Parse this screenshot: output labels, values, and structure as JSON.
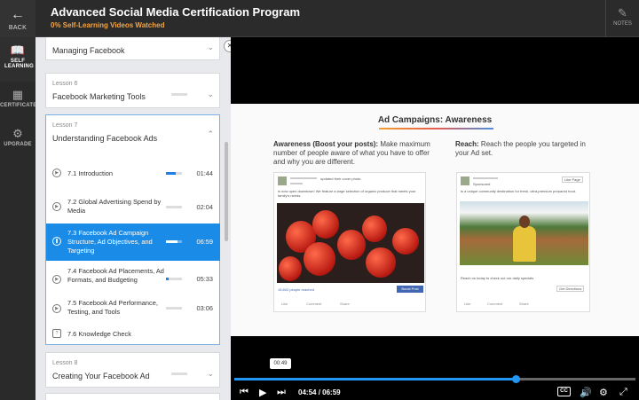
{
  "header": {
    "back_label": "BACK",
    "title": "Advanced Social Media Certification Program",
    "subtitle": "0% Self-Learning Videos Watched",
    "notes_label": "NOTES"
  },
  "leftnav": {
    "items": [
      {
        "label": "SELF LEARNING",
        "icon": "book-icon"
      },
      {
        "label": "CERTIFICATE",
        "icon": "certificate-icon"
      },
      {
        "label": "UPGRADE",
        "icon": "upgrade-icon"
      }
    ]
  },
  "lessons": {
    "prev_card_title": "Managing Facebook",
    "lesson6": {
      "number": "Lesson 6",
      "title": "Facebook Marketing Tools"
    },
    "lesson7": {
      "number": "Lesson 7",
      "title": "Understanding Facebook Ads",
      "items": [
        {
          "label": "7.1 Introduction",
          "duration": "01:44",
          "progress": 0.6
        },
        {
          "label": "7.2 Global Advertising Spend by Media",
          "duration": "02:04",
          "progress": 0
        },
        {
          "label": "7.3 Facebook Ad Campaign Structure, Ad Objectives, and Targeting",
          "duration": "06:59",
          "progress": 0.7
        },
        {
          "label": "7.4 Facebook Ad Placements, Ad Formats, and Budgeting",
          "duration": "05:33",
          "progress": 0.15
        },
        {
          "label": "7.5 Facebook Ad Performance, Testing, and Tools",
          "duration": "03:06",
          "progress": 0
        },
        {
          "label": "7.6 Knowledge Check",
          "duration": "",
          "progress": 0
        }
      ]
    },
    "lesson8": {
      "number": "Lesson 8",
      "title": "Creating Your Facebook Ad"
    }
  },
  "slide": {
    "title": "Ad Campaigns: Awareness",
    "left_head_bold": "Awareness (Boost your posts):",
    "left_head_rest": " Make maximum number of people aware of what you have to offer and why you are different.",
    "right_head_bold": "Reach:",
    "right_head_rest": " Reach the people you targeted in your Ad set.",
    "post1": {
      "action": "updated their cover photo.",
      "text": "is now open downtown! We feature a large selection of organic produce that meets your family's needs.",
      "reached": "15,602 people reached",
      "boost": "Boost Post",
      "like": "Like",
      "comment": "Comment",
      "share": "Share"
    },
    "post2": {
      "sponsored": "Sponsored",
      "like_page": "Like Page",
      "text": "is a unique community destination for fresh, ultra-premium prepared food.",
      "caption": "Reach us today to check out our daily specials",
      "directions": "Get Directions",
      "like": "Like",
      "comment": "Comment",
      "share": "Share"
    }
  },
  "player": {
    "tooltip": "00:49",
    "current": "04:54",
    "separator": " / ",
    "total": "06:59",
    "progress": 0.7,
    "cc_label": "CC"
  }
}
